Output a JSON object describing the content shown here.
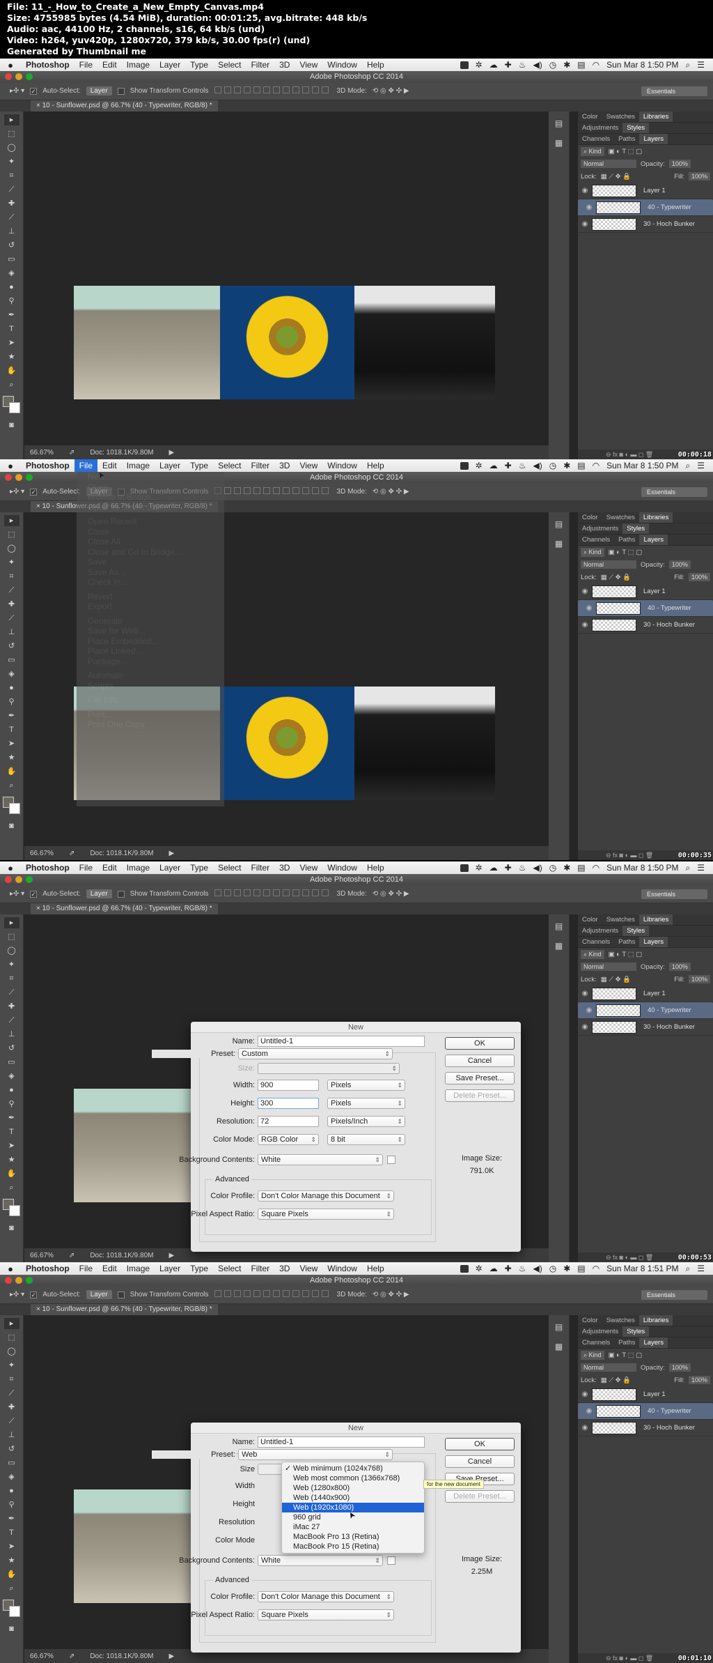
{
  "header": {
    "lines": [
      "File: 11_-_How_to_Create_a_New_Empty_Canvas.mp4",
      "Size: 4755985 bytes (4.54 MiB), duration: 00:01:25, avg.bitrate: 448 kb/s",
      "Audio: aac, 44100 Hz, 2 channels, s16, 64 kb/s (und)",
      "Video: h264, yuv420p, 1280x720, 379 kb/s, 30.00 fps(r) (und)",
      "Generated by Thumbnail me"
    ]
  },
  "common": {
    "apple_icon": "",
    "menu": [
      "Photoshop",
      "File",
      "Edit",
      "Image",
      "Layer",
      "Type",
      "Select",
      "Filter",
      "3D",
      "View",
      "Window",
      "Help"
    ],
    "window_title": "Adobe Photoshop CC 2014",
    "options": {
      "auto_select_label": "Auto-Select:",
      "auto_select_value": "Layer",
      "show_transform_label": "Show Transform Controls",
      "mode_3d_label": "3D Mode:",
      "workspace": "Essentials"
    },
    "doc_tab": "10 - Sunflower.psd @ 66.7% (40 - Typewriter, RGB/8) *",
    "zoom": "66.67%",
    "doc_size": "Doc: 1018.1K/9.80M",
    "tools": [
      "move",
      "marquee",
      "lasso",
      "magic-wand",
      "crop",
      "eyedropper",
      "healing",
      "brush",
      "stamp",
      "history-brush",
      "eraser",
      "paint-bucket",
      "blur",
      "dodge",
      "pen",
      "type",
      "path-select",
      "shape",
      "hand",
      "zoom"
    ],
    "panels": {
      "row1": [
        "Color",
        "Swatches",
        "Libraries"
      ],
      "row1_active": "Libraries",
      "row2": [
        "Adjustments",
        "Styles"
      ],
      "row2_active": "Styles",
      "row3": [
        "Channels",
        "Paths",
        "Layers"
      ],
      "row3_active": "Layers",
      "filter_kind": "Kind",
      "blend_mode": "Normal",
      "opacity_label": "Opacity:",
      "opacity": "100%",
      "lock_label": "Lock:",
      "fill_label": "Fill:",
      "fill": "100%",
      "layers": [
        {
          "name": "Layer 1",
          "selected": false
        },
        {
          "name": "40 - Typewriter",
          "selected": true
        },
        {
          "name": "30 - Hoch Bunker",
          "selected": false
        }
      ],
      "footer_icons": "⊖  fx  ◙  ◐  ▬  ◻  🗑"
    }
  },
  "frames": [
    {
      "clock": "Sun Mar 8  1:50 PM",
      "timestamp": "00:00:18"
    },
    {
      "clock": "Sun Mar 8  1:50 PM",
      "timestamp": "00:00:35",
      "file_menu": [
        "New...",
        "Open...",
        "Browse in Bridge...",
        "Open as Smart Object...",
        "Open Recent",
        "Close",
        "Close All",
        "Close and Go to Bridge...",
        "Save",
        "Save As...",
        "Check In...",
        "Revert",
        "Export",
        "Generate",
        "Save for Web...",
        "Place Embedded...",
        "Place Linked...",
        "Package...",
        "Automate",
        "Scripts",
        "File Info...",
        "Print...",
        "Print One Copy"
      ]
    },
    {
      "clock": "Sun Mar 8  1:50 PM",
      "timestamp": "00:00:53",
      "dialog": {
        "title": "New",
        "name_label": "Name:",
        "name": "Untitled-1",
        "preset_label": "Preset:",
        "preset": "Custom",
        "size_label": "Size:",
        "size": "",
        "width_label": "Width:",
        "width": "900",
        "width_unit": "Pixels",
        "height_label": "Height:",
        "height": "300",
        "height_unit": "Pixels",
        "resolution_label": "Resolution:",
        "resolution": "72",
        "resolution_unit": "Pixels/Inch",
        "color_mode_label": "Color Mode:",
        "color_mode": "RGB Color",
        "bit_depth": "8 bit",
        "background_label": "Background Contents:",
        "background": "White",
        "advanced_label": "Advanced",
        "color_profile_label": "Color Profile:",
        "color_profile": "Don't Color Manage this Document",
        "aspect_label": "Pixel Aspect Ratio:",
        "aspect": "Square Pixels",
        "image_size_label": "Image Size:",
        "image_size": "791.0K",
        "ok": "OK",
        "cancel": "Cancel",
        "save_preset": "Save Preset...",
        "delete_preset": "Delete Preset..."
      }
    },
    {
      "clock": "Sun Mar 8  1:51 PM",
      "timestamp": "00:01:10",
      "dialog": {
        "title": "New",
        "name_label": "Name:",
        "name": "Untitled-1",
        "preset_label": "Preset:",
        "preset": "Web",
        "size_label": "Size",
        "width_label": "Width",
        "height_label": "Height",
        "resolution_label": "Resolution",
        "color_mode_label": "Color Mode",
        "background_label": "Background Contents:",
        "background": "White",
        "advanced_label": "Advanced",
        "color_profile_label": "Color Profile:",
        "color_profile": "Don't Color Manage this Document",
        "aspect_label": "Pixel Aspect Ratio:",
        "aspect": "Square Pixels",
        "image_size_label": "Image Size:",
        "image_size": "2.25M",
        "ok": "OK",
        "cancel": "Cancel",
        "save_preset": "Save Preset...",
        "delete_preset": "Delete Preset...",
        "tooltip": "for the new document",
        "size_options": [
          {
            "label": "Web minimum (1024x768)",
            "checked": true
          },
          {
            "label": "Web most common (1366x768)"
          },
          {
            "label": "Web (1280x800)"
          },
          {
            "label": "Web (1440x900)"
          },
          {
            "label": "Web (1920x1080)",
            "highlighted": true
          },
          {
            "label": "960 grid"
          },
          {
            "label": "iMac 27"
          },
          {
            "label": "MacBook Pro 13 (Retina)"
          },
          {
            "label": "MacBook Pro 15 (Retina)"
          }
        ]
      }
    }
  ],
  "colors": {
    "menu_highlight": "#2a6fd6",
    "dropdown_highlight": "#1f64d6",
    "layer_selected": "#5a6a84"
  }
}
